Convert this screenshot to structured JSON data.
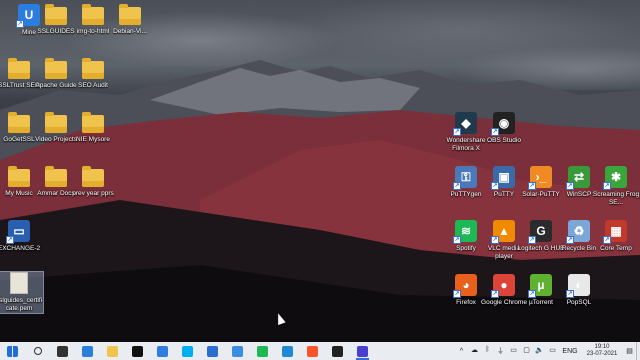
{
  "desktop_icons": [
    {
      "id": "mine",
      "label": "Mine",
      "kind": "app",
      "color": "#2b7de0",
      "glyph": "U"
    },
    {
      "id": "sslguides",
      "label": "SSLGUIDES",
      "kind": "folder"
    },
    {
      "id": "img-to-html",
      "label": "img-to-html",
      "kind": "folder"
    },
    {
      "id": "debian-vi",
      "label": "Debian-Vi...",
      "kind": "folder"
    },
    {
      "id": "ssltrust-seo",
      "label": "SSLTrust SEO",
      "kind": "folder"
    },
    {
      "id": "apache-guide",
      "label": "Apache Guide",
      "kind": "folder"
    },
    {
      "id": "seo-audit",
      "label": "SEO Audit",
      "kind": "folder"
    },
    {
      "id": "getssl",
      "label": "GoGetSSL",
      "kind": "folder"
    },
    {
      "id": "video-projects",
      "label": "Video Projects",
      "kind": "folder"
    },
    {
      "id": "nie-mysore",
      "label": "NIE Mysore",
      "kind": "folder"
    },
    {
      "id": "my-music",
      "label": "My Music",
      "kind": "folder"
    },
    {
      "id": "ammar-docs",
      "label": "Ammar Docs",
      "kind": "folder"
    },
    {
      "id": "prev-year-pprs",
      "label": "prev year pprs",
      "kind": "folder"
    },
    {
      "id": "exchange-2",
      "label": "EXCHANGE-2",
      "kind": "app",
      "color": "#2a5fb0",
      "glyph": "▭"
    },
    {
      "id": "sslguides-cert",
      "label": "sslguides_certificate.pem",
      "kind": "doc"
    },
    {
      "id": "filmora",
      "label": "Wondershare Filmora X",
      "kind": "app",
      "color": "#1f3a4a",
      "glyph": "◆"
    },
    {
      "id": "obs",
      "label": "OBS Studio",
      "kind": "app",
      "color": "#222",
      "glyph": "◉"
    },
    {
      "id": "puttygen",
      "label": "PuTTYgen",
      "kind": "app",
      "color": "#4a78b8",
      "glyph": "⚿"
    },
    {
      "id": "putty",
      "label": "PuTTY",
      "kind": "app",
      "color": "#3b6aa8",
      "glyph": "▣"
    },
    {
      "id": "solar-putty",
      "label": "Solar-PuTTY",
      "kind": "app",
      "color": "#f08a24",
      "glyph": "›_"
    },
    {
      "id": "winscp",
      "label": "WinSCP",
      "kind": "app",
      "color": "#3a9a3a",
      "glyph": "⇄"
    },
    {
      "id": "screaming-frog",
      "label": "Screaming Frog SE...",
      "kind": "app",
      "color": "#3aa53a",
      "glyph": "✱"
    },
    {
      "id": "spotify",
      "label": "Spotify",
      "kind": "app",
      "color": "#1db954",
      "glyph": "≋"
    },
    {
      "id": "vlc",
      "label": "VLC media player",
      "kind": "app",
      "color": "#f08a00",
      "glyph": "▲"
    },
    {
      "id": "logitech",
      "label": "Logitech G HUB",
      "kind": "app",
      "color": "#2b2b2b",
      "glyph": "G"
    },
    {
      "id": "recycle-bin",
      "label": "Recycle Bin",
      "kind": "app",
      "color": "#7aa7d8",
      "glyph": "♻"
    },
    {
      "id": "core-temp",
      "label": "Core Temp",
      "kind": "app",
      "color": "#c0392b",
      "glyph": "▦"
    },
    {
      "id": "firefox",
      "label": "Firefox",
      "kind": "app",
      "color": "#e8601c",
      "glyph": "◕"
    },
    {
      "id": "chrome",
      "label": "Google Chrome",
      "kind": "app",
      "color": "#db4437",
      "glyph": "●"
    },
    {
      "id": "utorrent",
      "label": "µTorrent",
      "kind": "app",
      "color": "#5eb131",
      "glyph": "µ"
    },
    {
      "id": "popsql",
      "label": "PopSQL",
      "kind": "app",
      "color": "#e8e8e8",
      "glyph": "◐"
    }
  ],
  "taskbar": {
    "apps": [
      {
        "id": "start",
        "icon": "windows-icon",
        "color": "#1f6fd6",
        "active": false
      },
      {
        "id": "search",
        "icon": "search-icon",
        "color": "#333",
        "active": false
      },
      {
        "id": "task-view",
        "icon": "task-view-icon",
        "color": "#333",
        "active": false
      },
      {
        "id": "explorer-photos",
        "icon": "photos-icon",
        "color": "#2a7fd8",
        "active": false
      },
      {
        "id": "file-explorer",
        "icon": "folder-icon",
        "color": "#f0c44c",
        "active": false
      },
      {
        "id": "notion",
        "icon": "notion-icon",
        "color": "#111",
        "active": false
      },
      {
        "id": "mail",
        "icon": "mail-icon",
        "color": "#2f7de0",
        "active": false
      },
      {
        "id": "skype",
        "icon": "skype-icon",
        "color": "#00aff0",
        "active": false
      },
      {
        "id": "remote-desktop",
        "icon": "remote-desktop-icon",
        "color": "#2a6fd0",
        "active": false
      },
      {
        "id": "photos",
        "icon": "image-icon",
        "color": "#3a8de0",
        "active": false
      },
      {
        "id": "spotify",
        "icon": "spotify-icon",
        "color": "#1db954",
        "active": false
      },
      {
        "id": "vscode",
        "icon": "vscode-icon",
        "color": "#1f8ad2",
        "active": false
      },
      {
        "id": "brave",
        "icon": "brave-icon",
        "color": "#fb542b",
        "active": false
      },
      {
        "id": "github",
        "icon": "github-icon",
        "color": "#222",
        "active": false
      },
      {
        "id": "pycharm",
        "icon": "ide-icon",
        "color": "#4a3fd0",
        "active": true
      }
    ],
    "tray": {
      "chevron": "^",
      "items": [
        "cloud-icon",
        "bluetooth-icon",
        "usb-icon",
        "network-icon",
        "display-icon",
        "speaker-icon",
        "chat-icon"
      ],
      "language": "ENG",
      "time": "19:10",
      "date": "23-07-2021"
    }
  }
}
